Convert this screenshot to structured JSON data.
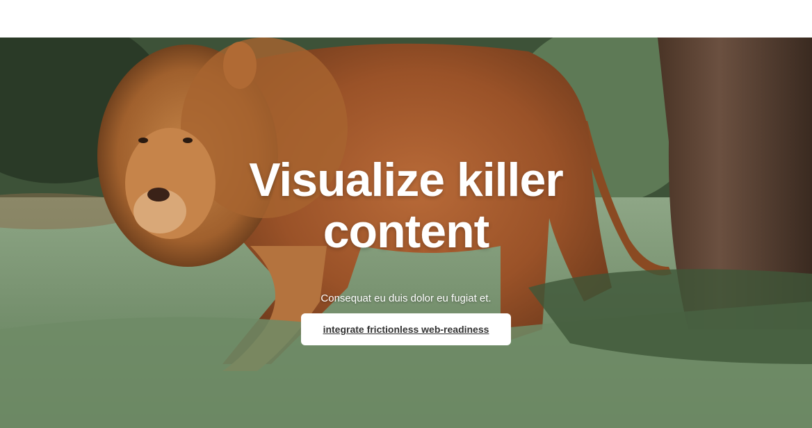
{
  "hero": {
    "headline_line1": "Visualize killer",
    "headline_line2": "content",
    "subtitle": "Consequat eu duis dolor eu fugiat et.",
    "cta_label": "integrate frictionless web-readiness",
    "background_image": "lion-walking-in-grass-photo"
  },
  "colors": {
    "header_bg": "#ffffff",
    "headline_text": "#ffffff",
    "cta_bg": "#ffffff",
    "cta_text": "#333333"
  }
}
